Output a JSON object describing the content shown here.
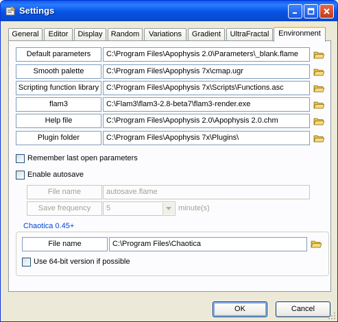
{
  "window": {
    "title": "Settings"
  },
  "tabs": [
    "General",
    "Editor",
    "Display",
    "Random",
    "Variations",
    "Gradient",
    "UltraFractal",
    "Environment"
  ],
  "paths": [
    {
      "label": "Default parameters",
      "value": "C:\\Program Files\\Apophysis 2.0\\Parameters\\_blank.flame"
    },
    {
      "label": "Smooth palette",
      "value": "C:\\Program Files\\Apophysis 7x\\cmap.ugr"
    },
    {
      "label": "Scripting function library",
      "value": "C:\\Program Files\\Apophysis 7x\\Scripts\\Functions.asc"
    },
    {
      "label": "flam3",
      "value": "C:\\Flam3\\flam3-2.8-beta7\\flam3-render.exe"
    },
    {
      "label": "Help file",
      "value": "C:\\Program Files\\Apophysis 2.0\\Apophysis 2.0.chm"
    },
    {
      "label": "Plugin folder",
      "value": "C:\\Program Files\\Apophysis 7x\\Plugins\\"
    }
  ],
  "remember_last": {
    "label": "Remember last open parameters",
    "checked": false
  },
  "autosave": {
    "label": "Enable autosave",
    "checked": false,
    "file_name_label": "File name",
    "file_name_value": "autosave.flame",
    "freq_label": "Save frequency",
    "freq_value": "5",
    "freq_unit": "minute(s)"
  },
  "chaotica": {
    "group_title": "Chaotica 0.45+",
    "file_name_label": "File name",
    "file_name_value": "C:\\Program Files\\Chaotica",
    "use64_label": "Use 64-bit version if possible",
    "use64_checked": false
  },
  "buttons": {
    "ok": "OK",
    "cancel": "Cancel"
  },
  "colors": {
    "titlebar": "#0553e3",
    "group_title": "#0046d5",
    "tab_highlight": "#ffc83c"
  }
}
